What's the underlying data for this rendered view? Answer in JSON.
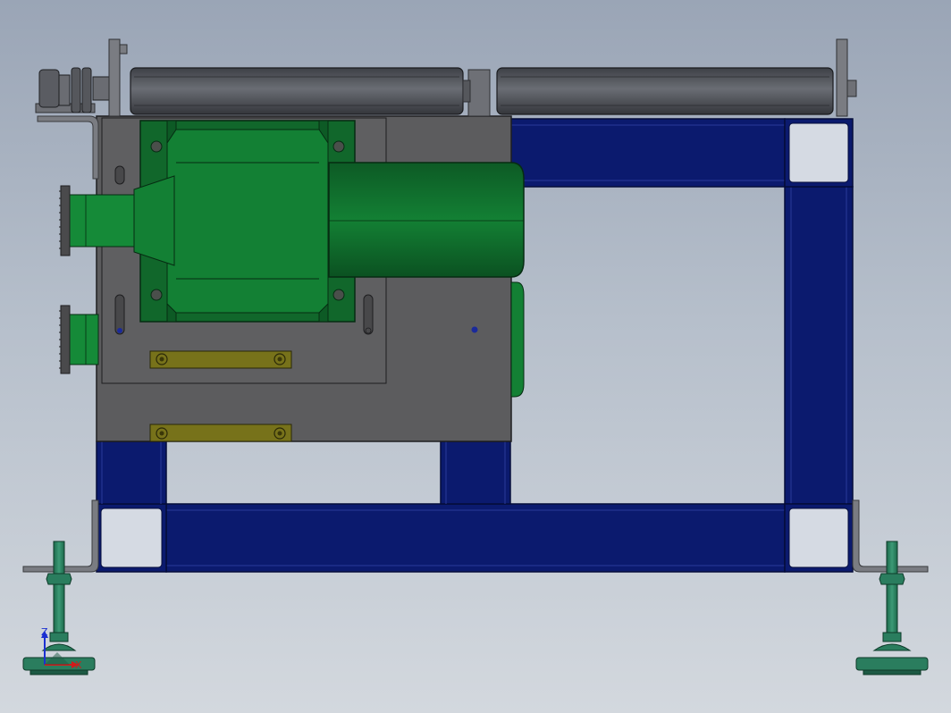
{
  "viewport": {
    "background_top": "#9aa5b6",
    "background_bottom": "#d3d8de"
  },
  "colors": {
    "frame_blue": "#0b1a6e",
    "frame_edge": "#0a1560",
    "corner_block": "#d5dae3",
    "plate_gray": "#5c5c5e",
    "motor_green": "#11672b",
    "motor_green_dark": "#0a4e1f",
    "slot_bar": "#77721a",
    "roller_gray": "#4f5259",
    "foot_teal": "#2a7d5e",
    "bracket_gray": "#7a7c82"
  },
  "triad": {
    "z_label": "Z",
    "x_label": "X",
    "z_color": "#1b2fd1",
    "x_color": "#d11b1b"
  },
  "icons": {
    "triad": "coordinate-triad-icon",
    "sprocket": "sprocket-icon",
    "leveling_foot": "leveling-foot-icon"
  }
}
